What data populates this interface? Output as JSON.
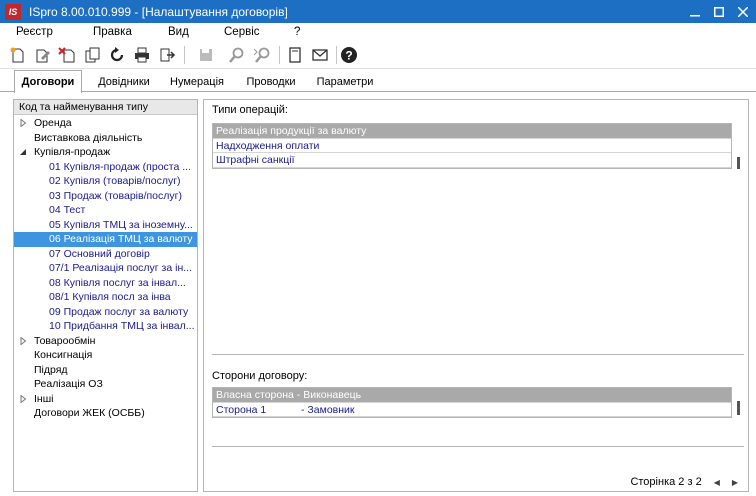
{
  "window": {
    "logo": "IS",
    "title": "ISpro 8.00.010.999 - [Налаштування договорів]",
    "controls": [
      "minimize",
      "maximize",
      "close"
    ]
  },
  "menu": [
    "Реєстр",
    "Правка",
    "Вид",
    "Сервіс",
    "?"
  ],
  "toolbar": {
    "icons": [
      "new-doc-icon",
      "edit-icon",
      "delete-icon",
      "copy-icon",
      "refresh-icon",
      "print-icon",
      "export-icon",
      "save-icon",
      "find-icon",
      "find-next-icon",
      "note-icon",
      "mail-icon",
      "help-icon"
    ]
  },
  "tabs": [
    {
      "label": "Договори",
      "active": true
    },
    {
      "label": "Довідники",
      "active": false
    },
    {
      "label": "Нумерація",
      "active": false
    },
    {
      "label": "Проводки",
      "active": false
    },
    {
      "label": "Параметри",
      "active": false
    }
  ],
  "tree": {
    "header": "Код та найменування типу",
    "items": [
      {
        "label": "Оренда",
        "level": 0,
        "arrow": "collapsed"
      },
      {
        "label": "Виставкова діяльність",
        "level": 0,
        "arrow": "none"
      },
      {
        "label": "Купівля-продаж",
        "level": 0,
        "arrow": "expanded"
      },
      {
        "label": "01 Купівля-продаж (проста ...",
        "level": 1,
        "arrow": "none"
      },
      {
        "label": "02 Купівля (товарів/послуг)",
        "level": 1,
        "arrow": "none"
      },
      {
        "label": "03 Продаж (товарів/послуг)",
        "level": 1,
        "arrow": "none"
      },
      {
        "label": "04 Тест",
        "level": 1,
        "arrow": "none"
      },
      {
        "label": "05 Купівля ТМЦ за іноземну...",
        "level": 1,
        "arrow": "none"
      },
      {
        "label": "06 Реалізація ТМЦ за валюту",
        "level": 1,
        "arrow": "none",
        "selected": true
      },
      {
        "label": "07 Основний договір",
        "level": 1,
        "arrow": "none"
      },
      {
        "label": "07/1 Реалізація послуг за ін...",
        "level": 1,
        "arrow": "none"
      },
      {
        "label": "08 Купівля послуг за інвал...",
        "level": 1,
        "arrow": "none"
      },
      {
        "label": "08/1 Купівля посл за інва",
        "level": 1,
        "arrow": "none"
      },
      {
        "label": "09 Продаж послуг за валюту",
        "level": 1,
        "arrow": "none"
      },
      {
        "label": "10 Придбання ТМЦ за інвал...",
        "level": 1,
        "arrow": "none"
      },
      {
        "label": "Товарообмін",
        "level": 0,
        "arrow": "collapsed"
      },
      {
        "label": "Консигнація",
        "level": 0,
        "arrow": "none"
      },
      {
        "label": "Підряд",
        "level": 0,
        "arrow": "none"
      },
      {
        "label": "Реалізація ОЗ",
        "level": 0,
        "arrow": "none"
      },
      {
        "label": "Інші",
        "level": 0,
        "arrow": "collapsed"
      },
      {
        "label": "Договори ЖЕК (ОСББ)",
        "level": 0,
        "arrow": "none"
      }
    ]
  },
  "operations": {
    "label": "Типи операцій:",
    "rows": [
      {
        "text": "Реалізація продукції за валюту",
        "selected": true
      },
      {
        "text": "Надходження оплати",
        "selected": false
      },
      {
        "text": "Штрафні санкції",
        "selected": false
      }
    ]
  },
  "parties": {
    "label": "Сторони договору:",
    "rows": [
      {
        "col1": "Власна сторона",
        "col2": "- Виконавець",
        "selected": true
      },
      {
        "col1": "Сторона 1",
        "col2": "- Замовник",
        "selected": false
      }
    ]
  },
  "pager": {
    "text": "Сторінка 2 з 2"
  }
}
